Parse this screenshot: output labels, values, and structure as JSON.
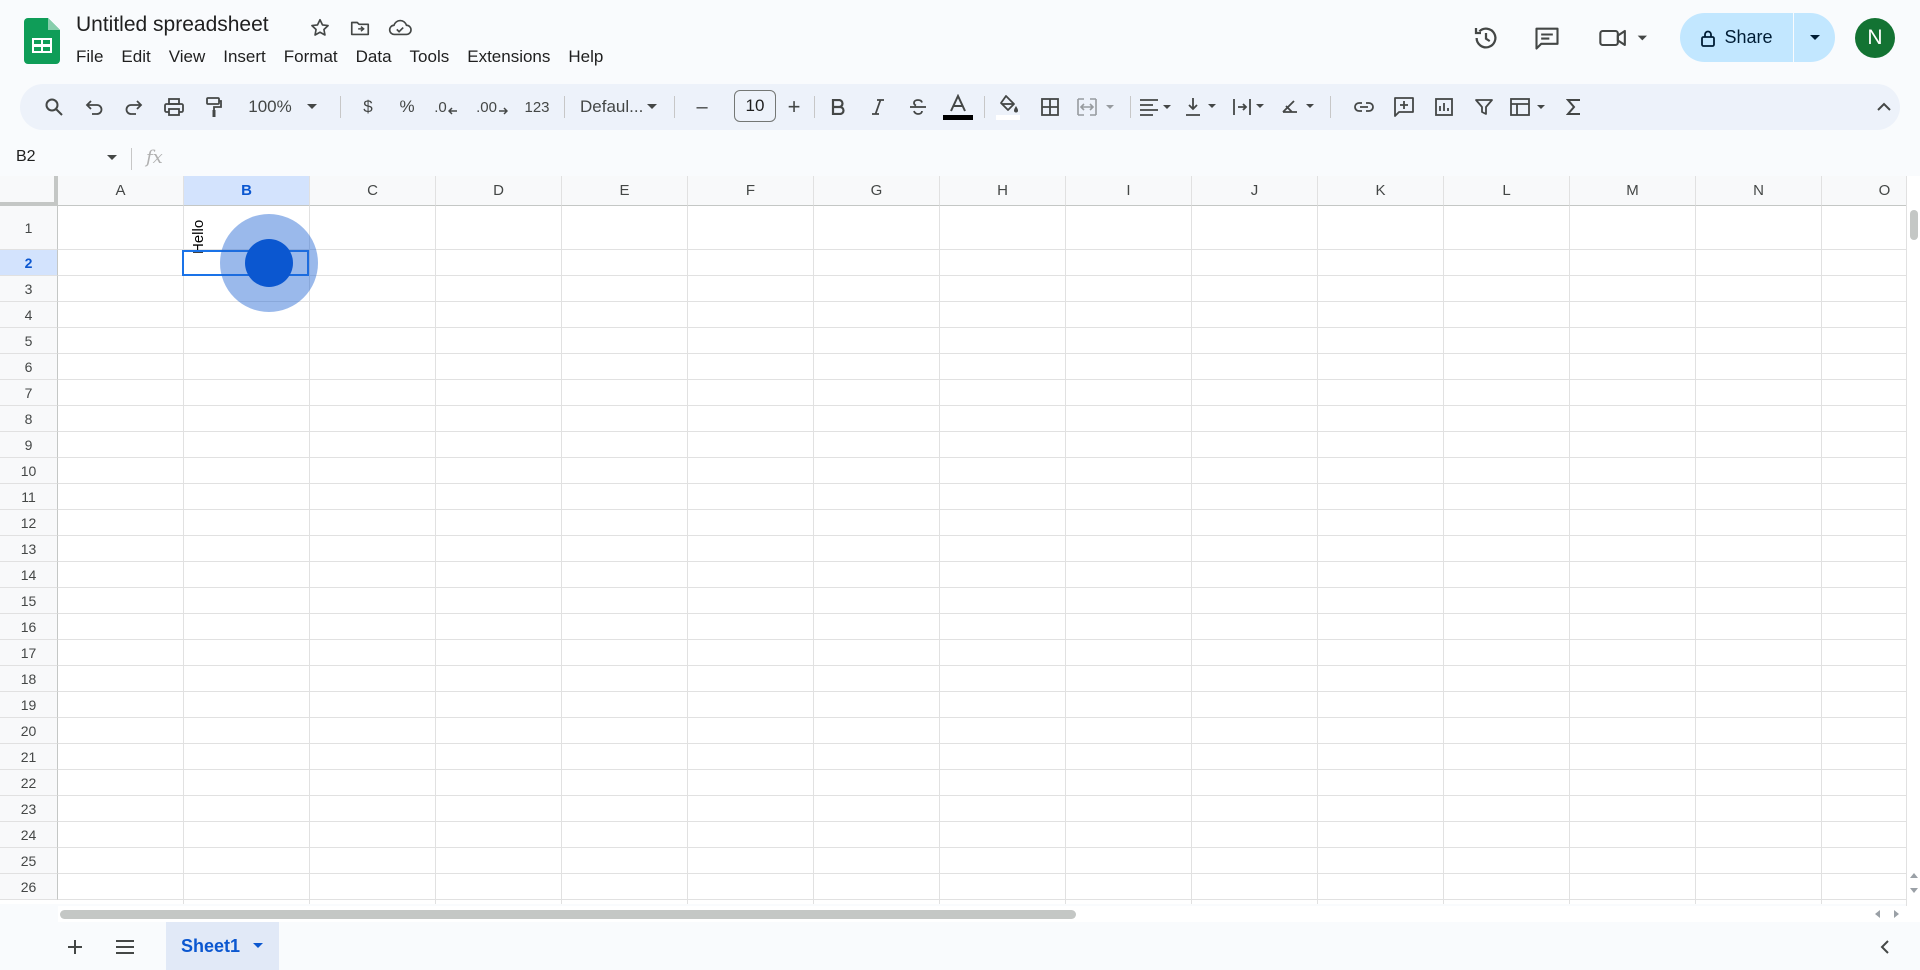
{
  "doc": {
    "title": "Untitled spreadsheet"
  },
  "menu": [
    "File",
    "Edit",
    "View",
    "Insert",
    "Format",
    "Data",
    "Tools",
    "Extensions",
    "Help"
  ],
  "share": {
    "label": "Share"
  },
  "user": {
    "initial": "N"
  },
  "toolbar": {
    "zoom": "100%",
    "currency": "$",
    "percent": "%",
    "dec_decrease": ".0",
    "dec_increase": ".00",
    "number_format": "123",
    "font": "Defaul...",
    "font_size": "10",
    "minus": "–",
    "plus": "+"
  },
  "formula_bar": {
    "name_box": "B2",
    "fx": "fx",
    "value": ""
  },
  "columns": [
    "A",
    "B",
    "C",
    "D",
    "E",
    "F",
    "G",
    "H",
    "I",
    "J",
    "K",
    "L",
    "M",
    "N",
    "O"
  ],
  "selected_column": "B",
  "rows": [
    "1",
    "2",
    "3",
    "4",
    "5",
    "6",
    "7",
    "8",
    "9",
    "10",
    "11",
    "12",
    "13",
    "14",
    "15",
    "16",
    "17",
    "18",
    "19",
    "20",
    "21",
    "22",
    "23",
    "24",
    "25",
    "26"
  ],
  "selected_row": "2",
  "cells": {
    "B1": "Hello"
  },
  "sheets": [
    {
      "name": "Sheet1",
      "active": true
    }
  ],
  "colors": {
    "accent": "#0b57d0",
    "share_bg": "#c2e7ff",
    "avatar_bg": "#137333",
    "sheets_green": "#0f9d58"
  }
}
